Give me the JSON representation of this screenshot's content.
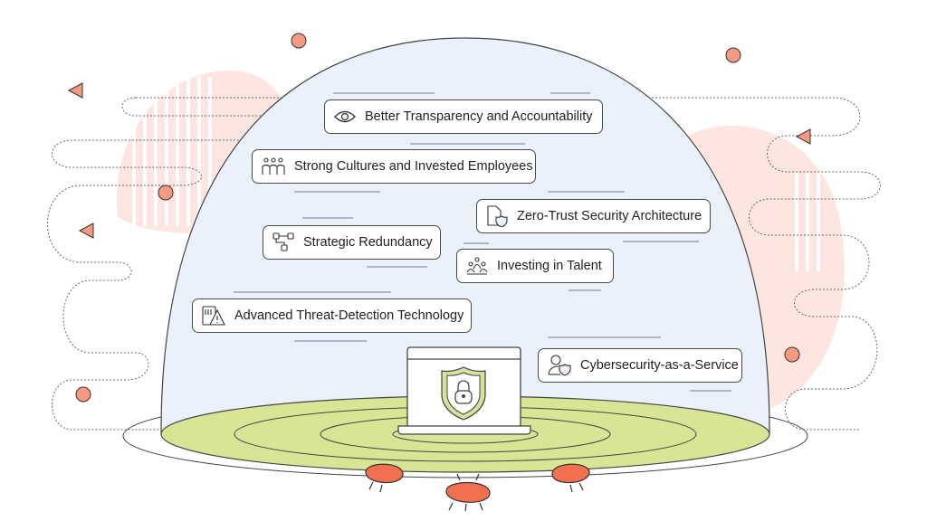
{
  "features": [
    {
      "label": "Better Transparency and Accountability",
      "icon": "eye-icon"
    },
    {
      "label": "Strong Cultures and Invested Employees",
      "icon": "people-group-icon"
    },
    {
      "label": "Zero-Trust Security Architecture",
      "icon": "document-shield-icon"
    },
    {
      "label": "Strategic Redundancy",
      "icon": "network-nodes-icon"
    },
    {
      "label": "Investing in Talent",
      "icon": "team-icon"
    },
    {
      "label": "Advanced Threat-Detection Technology",
      "icon": "warning-panel-icon"
    },
    {
      "label": "Cybersecurity-as-a-Service",
      "icon": "user-shield-icon"
    }
  ],
  "colors": {
    "dome": "#eaf1fb",
    "ground": "#d9e495",
    "accent": "#f07a55",
    "blob": "#fde6e0",
    "shield": "#d4e29b"
  }
}
